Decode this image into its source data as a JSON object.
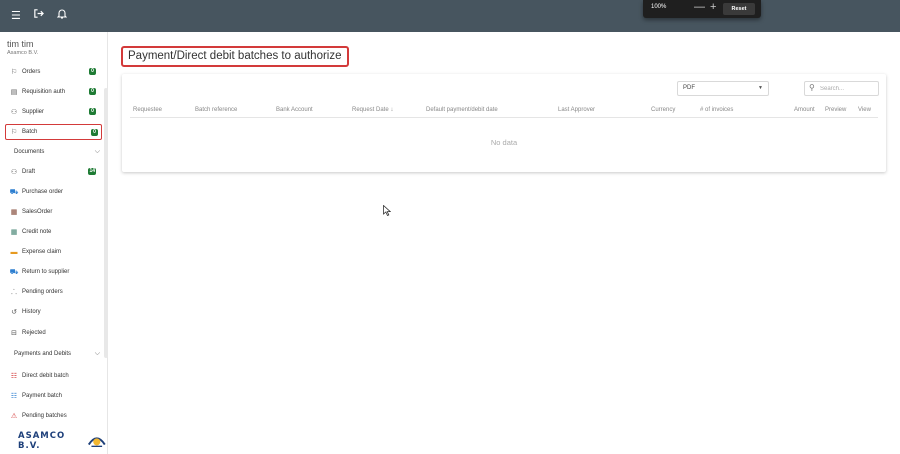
{
  "topbar": {
    "icons": [
      "menu-icon",
      "logout-icon",
      "bell-icon"
    ],
    "zoom": {
      "percent": "100%",
      "minus": "—",
      "plus": "+",
      "reset": "Reset"
    }
  },
  "sidebar": {
    "user_name": "tim tim",
    "company": "Asamco B.V.",
    "items": [
      {
        "label": "Orders",
        "badge": "0",
        "icon": "flag-icon"
      },
      {
        "label": "Requisition auth",
        "badge": "0",
        "icon": "list-icon"
      },
      {
        "label": "Supplier",
        "badge": "0",
        "icon": "users-icon"
      },
      {
        "label": "Batch",
        "badge": "0",
        "icon": "flag-icon"
      }
    ],
    "documents_section": "Documents",
    "documents": [
      {
        "label": "Draft",
        "badge": "14",
        "icon": "users-icon"
      },
      {
        "label": "Purchase order",
        "icon": "cart-icon"
      },
      {
        "label": "SalesOrder",
        "icon": "bank-icon"
      },
      {
        "label": "Credit note",
        "icon": "bank-icon"
      },
      {
        "label": "Expense claim",
        "icon": "wallet-icon"
      },
      {
        "label": "Return to supplier",
        "icon": "truck-icon"
      },
      {
        "label": "Pending orders",
        "icon": "network-icon"
      },
      {
        "label": "History",
        "icon": "history-icon"
      },
      {
        "label": "Rejected",
        "icon": "rejected-icon"
      }
    ],
    "payments_section": "Payments and Debits",
    "payments": [
      {
        "label": "Direct debit batch",
        "icon": "list-icon"
      },
      {
        "label": "Payment batch",
        "icon": "list-icon"
      },
      {
        "label": "Pending batches",
        "icon": "warning-icon"
      }
    ],
    "logo_text": "ASAMCO B.V."
  },
  "main": {
    "title": "Payment/Direct debit batches to authorize",
    "export_format": "PDF",
    "search_placeholder": "Search...",
    "columns": [
      "Requestee",
      "Batch reference",
      "Bank Account",
      "Request Date ↓",
      "Default payment/debit date",
      "Last Approver",
      "Currency",
      "# of invoices",
      "Amount",
      "Preview",
      "View"
    ],
    "empty_text": "No data"
  }
}
